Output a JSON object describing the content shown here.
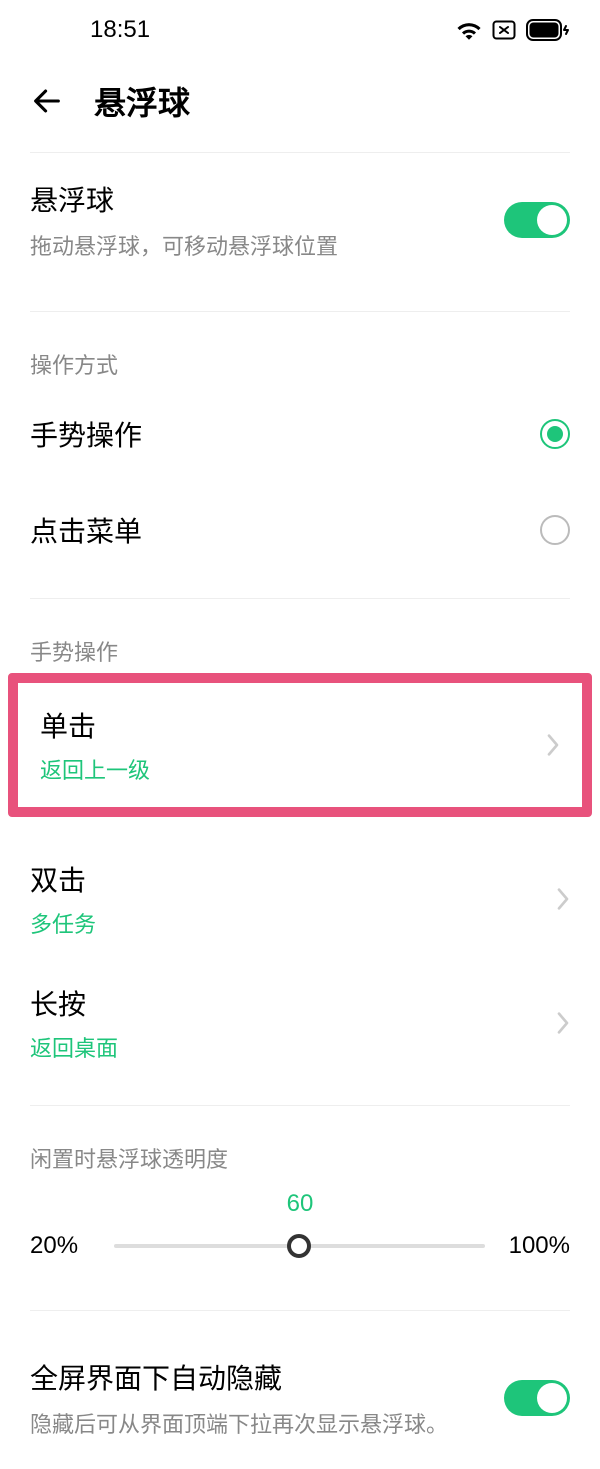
{
  "status": {
    "time": "18:51"
  },
  "header": {
    "title": "悬浮球"
  },
  "main_toggle": {
    "title": "悬浮球",
    "sub": "拖动悬浮球，可移动悬浮球位置",
    "on": true
  },
  "section_op": {
    "label": "操作方式"
  },
  "radio": {
    "gesture": {
      "label": "手势操作",
      "selected": true
    },
    "menu": {
      "label": "点击菜单",
      "selected": false
    }
  },
  "section_gesture": {
    "label": "手势操作"
  },
  "gesture_items": {
    "single": {
      "label": "单击",
      "value": "返回上一级"
    },
    "double": {
      "label": "双击",
      "value": "多任务"
    },
    "long": {
      "label": "长按",
      "value": "返回桌面"
    }
  },
  "opacity": {
    "label": "闲置时悬浮球透明度",
    "value": "60",
    "min": "20%",
    "max": "100%",
    "percent": 50
  },
  "auto_hide": {
    "title": "全屏界面下自动隐藏",
    "sub": "隐藏后可从界面顶端下拉再次显示悬浮球。",
    "on": true
  }
}
